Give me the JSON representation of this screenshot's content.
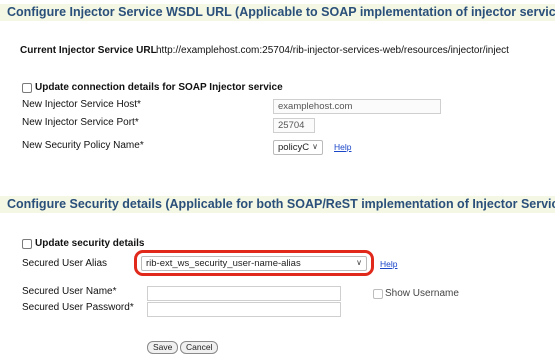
{
  "wsdl_section": {
    "title": "Configure Injector Service WSDL URL (Applicable to SOAP implementation of injector service)",
    "current_url_label": "Current Injector Service URL",
    "current_url_value": "http://examplehost.com:25704/rib-injector-services-web/resources/injector/inject",
    "update_checkbox_label": "Update connection details for SOAP Injector service",
    "host_label": "New Injector Service Host*",
    "host_value": "examplehost.com",
    "port_label": "New Injector Service Port*",
    "port_value": "25704",
    "policy_label": "New Security Policy Name*",
    "policy_value": "policyC",
    "policy_help": "Help"
  },
  "security_section": {
    "title": "Configure Security details (Applicable for both SOAP/ReST implementation of Injector Service)",
    "update_checkbox_label": "Update security details",
    "alias_label": "Secured User Alias",
    "alias_value": "rib-ext_ws_security_user-name-alias",
    "alias_help": "Help",
    "username_label": "Secured User Name*",
    "username_value": "",
    "show_username_label": "Show Username",
    "password_label": "Secured User Password*",
    "password_value": ""
  },
  "actions": {
    "save_label": "Save",
    "cancel_label": "Cancel"
  },
  "colors": {
    "header_text": "#2a4f7a",
    "header_background": "#f3f7e4",
    "highlight": "#e0281b",
    "link": "#1a46c8"
  }
}
